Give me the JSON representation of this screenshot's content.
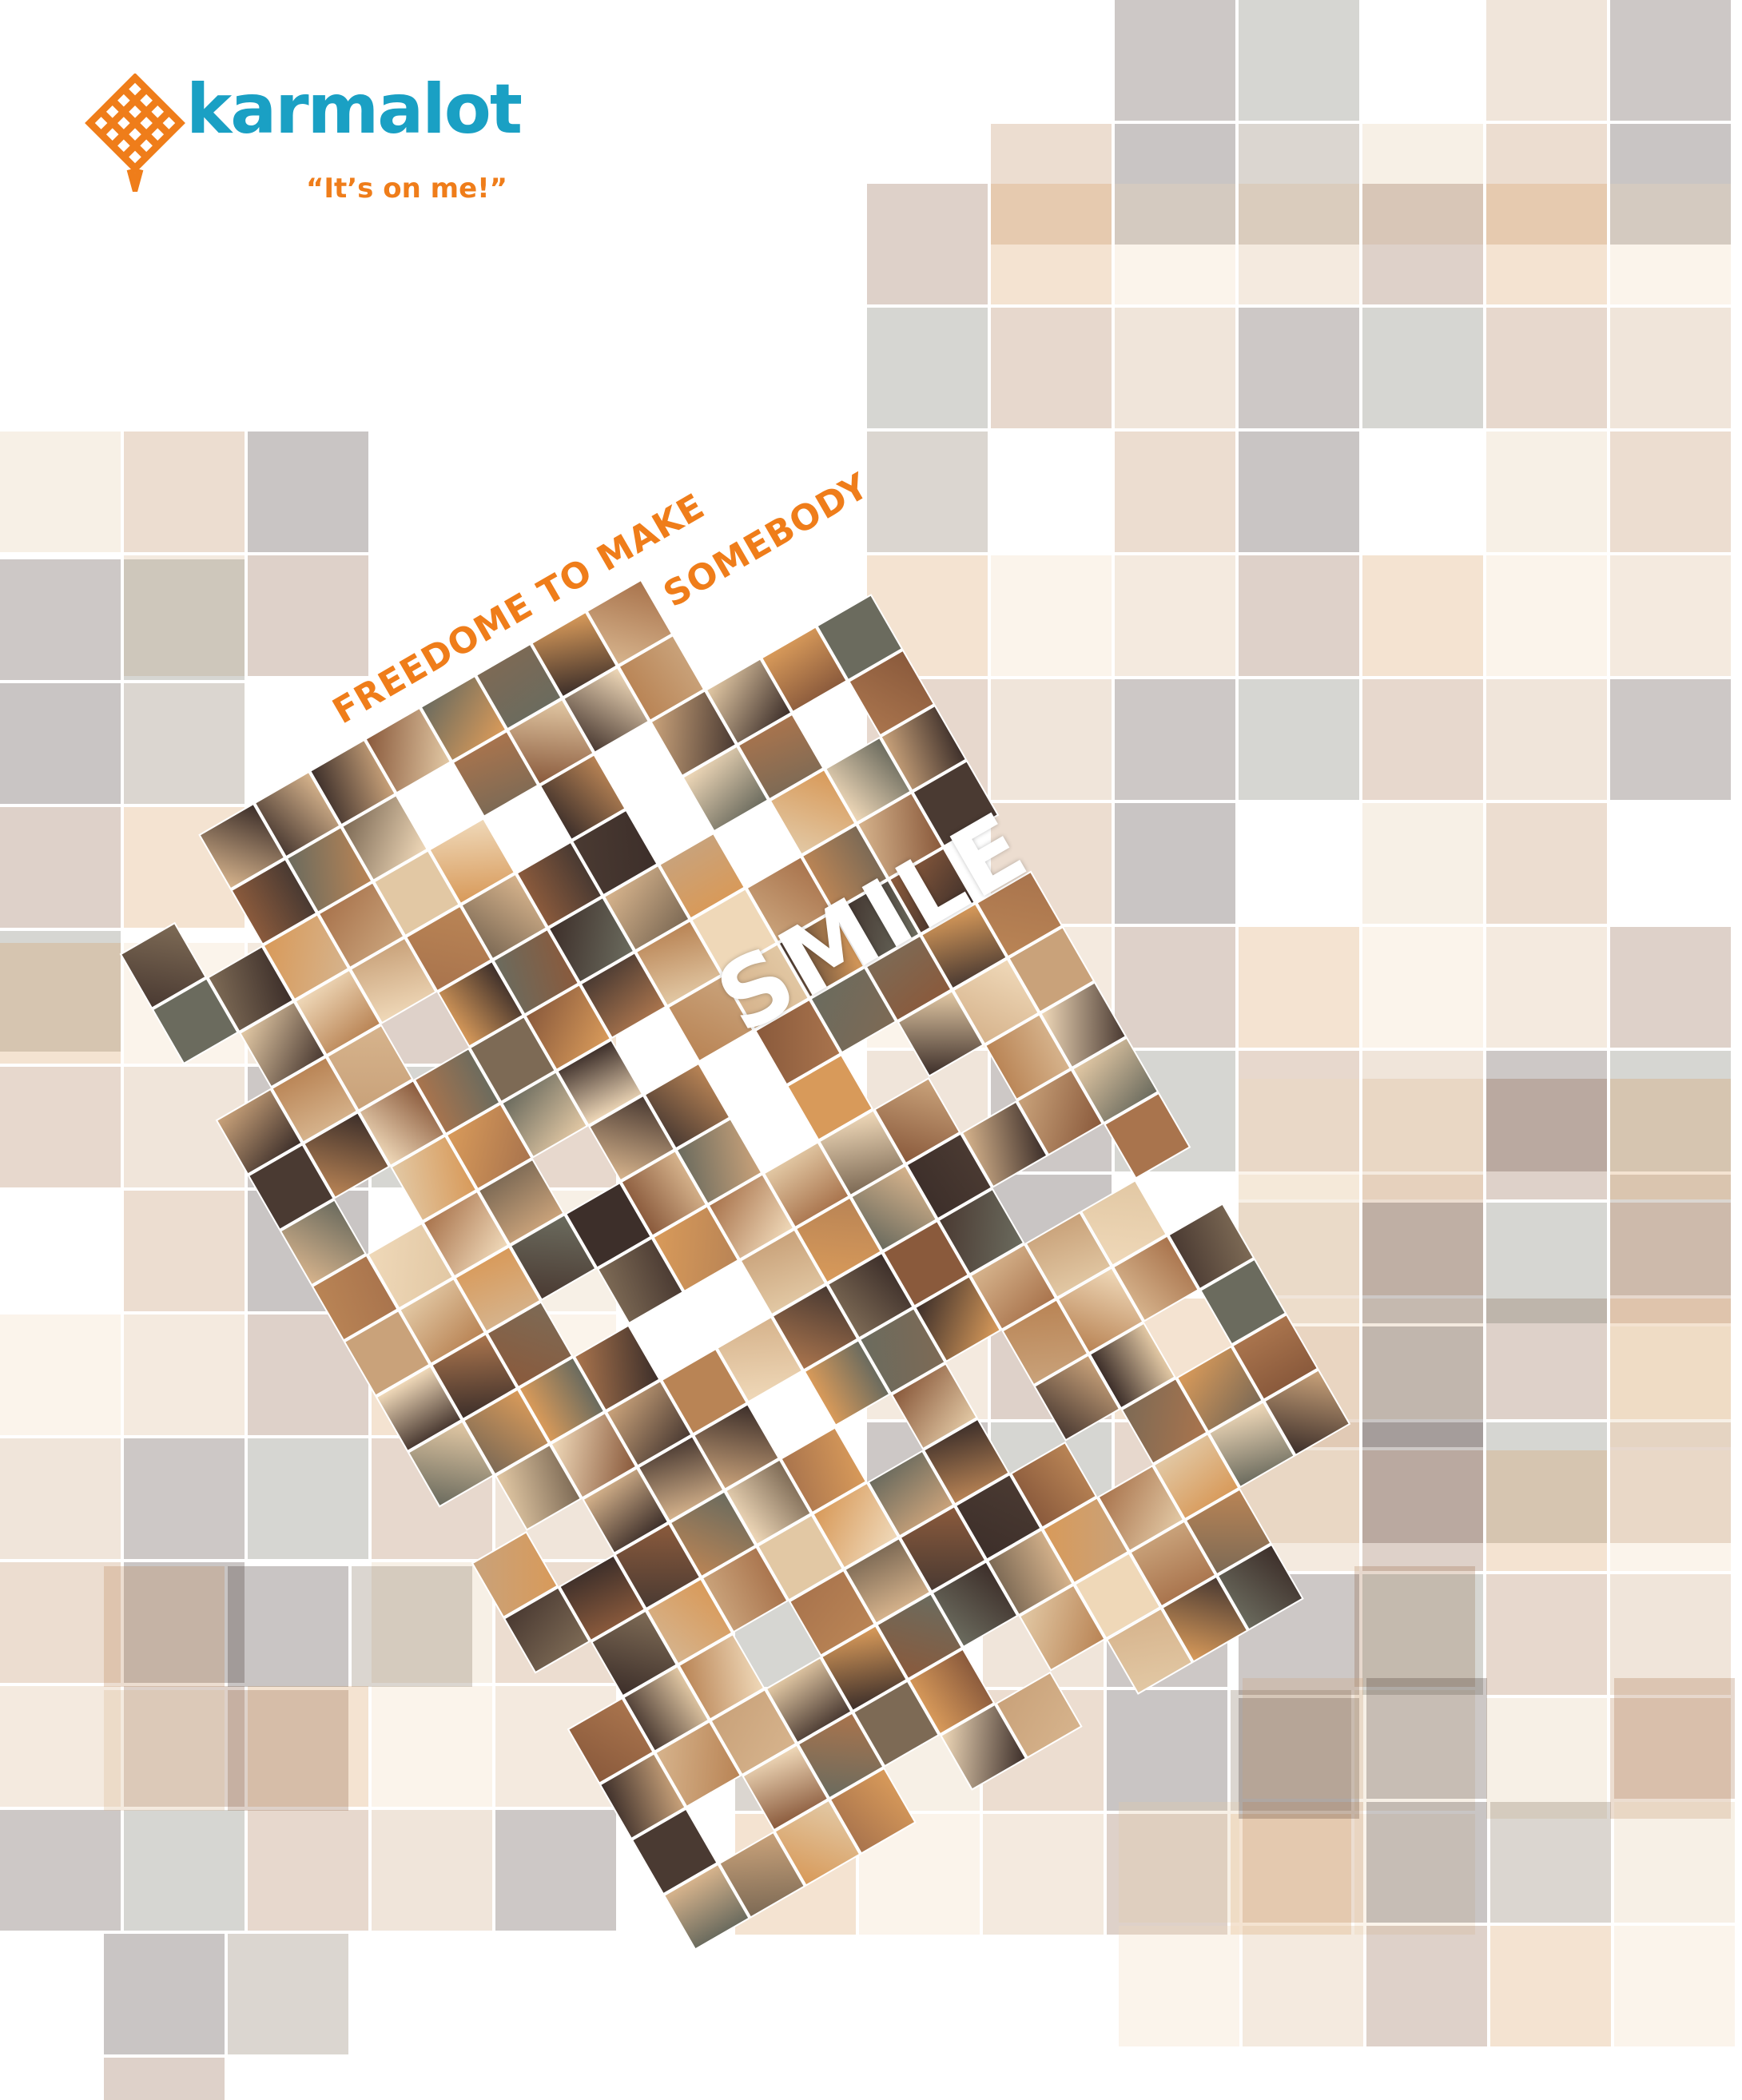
{
  "brand": {
    "name": "karmalot",
    "tagline": "“It’s on me!”",
    "name_color": "#1aa0c4",
    "accent_color": "#ef7d1a",
    "logo_icon": "endless-knot-icon"
  },
  "headline": {
    "line1": "FREEDOME TO MAKE",
    "line2": "SOMEBODY",
    "emphasis": "SMILE"
  },
  "palette": {
    "background": "#ffffff",
    "photo_tones": [
      "#c9a27a",
      "#8a5a3c",
      "#e2c8a4",
      "#4a3a32",
      "#d89a5a",
      "#b98455",
      "#6b6b5e",
      "#efd8b8",
      "#3d2f2a",
      "#a9744d",
      "#d6b38c",
      "#7d6a55"
    ]
  }
}
